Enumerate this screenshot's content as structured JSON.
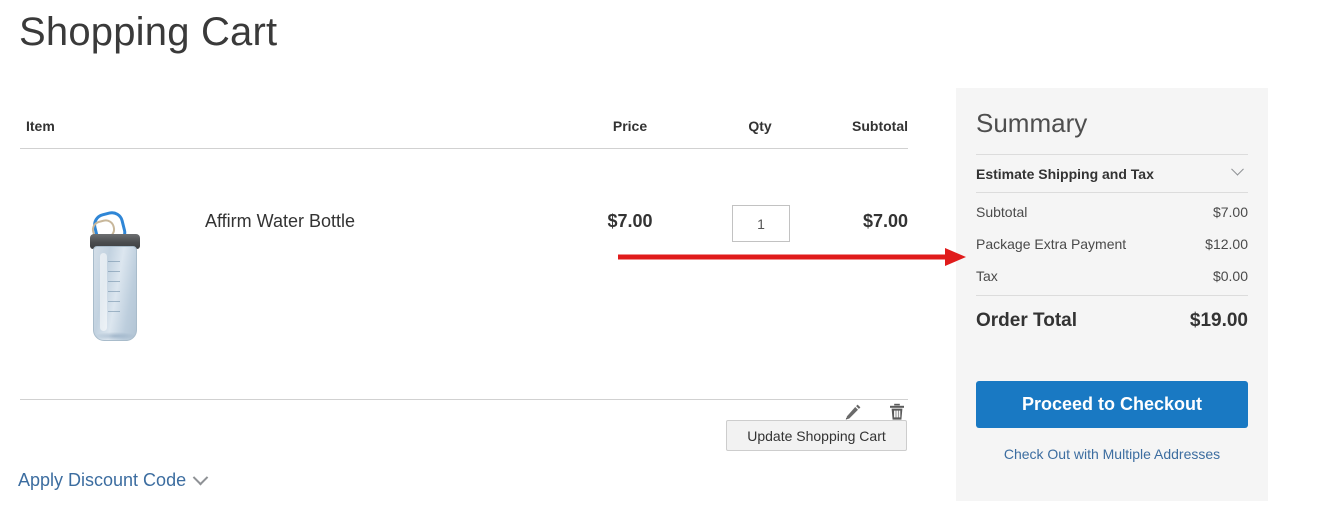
{
  "page": {
    "title": "Shopping Cart"
  },
  "cart_table": {
    "headers": {
      "item": "Item",
      "price": "Price",
      "qty": "Qty",
      "subtotal": "Subtotal"
    },
    "rows": [
      {
        "name": "Affirm Water Bottle",
        "price": "$7.00",
        "qty": "1",
        "subtotal": "$7.00",
        "image_alt": "water-bottle-product-image"
      }
    ],
    "row_actions": {
      "edit_icon": "pencil-icon",
      "remove_icon": "trash-icon"
    }
  },
  "actions": {
    "update_cart_label": "Update Shopping Cart",
    "apply_discount_label": "Apply Discount Code",
    "discount_chevron_icon": "chevron-down-icon"
  },
  "summary": {
    "title": "Summary",
    "estimate": {
      "label": "Estimate Shipping and Tax",
      "chevron_icon": "chevron-down-icon"
    },
    "totals": [
      {
        "label": "Subtotal",
        "value": "$7.00"
      },
      {
        "label": "Package Extra Payment",
        "value": "$12.00"
      },
      {
        "label": "Tax",
        "value": "$0.00"
      }
    ],
    "grand_total": {
      "label": "Order Total",
      "value": "$19.00"
    },
    "checkout_button": "Proceed to Checkout",
    "multi_address_link": "Check Out with Multiple Addresses"
  },
  "annotation": {
    "arrow_icon": "red-arrow-pointing-right",
    "color": "#e01b1b",
    "target": "Package Extra Payment"
  },
  "colors": {
    "accent_blue": "#1979c3",
    "link_blue": "#3c6da0",
    "panel_bg": "#f5f5f5",
    "annotation_red": "#e01b1b"
  }
}
